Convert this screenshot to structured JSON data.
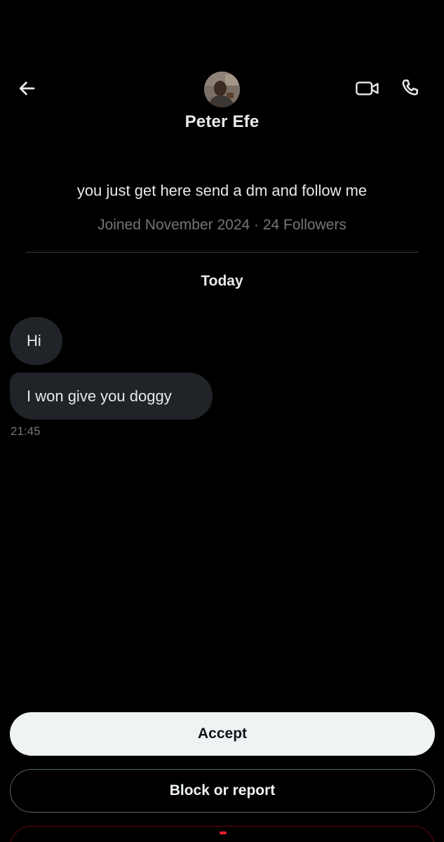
{
  "header": {
    "contact_name": "Peter Efe",
    "back_icon": "arrow-left-icon",
    "video_icon": "video-camera-icon",
    "call_icon": "phone-icon"
  },
  "profile": {
    "bio": "you just get here send a dm and follow me",
    "meta": "Joined November 2024 · 24 Followers"
  },
  "conversation": {
    "date_separator": "Today",
    "messages": [
      {
        "text": "Hi"
      },
      {
        "text": "I won give you doggy"
      }
    ],
    "timestamp": "21:45"
  },
  "actions": {
    "accept_label": "Accept",
    "block_label": "Block or report"
  },
  "colors": {
    "background": "#000000",
    "text_primary": "#e7e9ea",
    "text_secondary": "#71767b",
    "bubble": "#202327",
    "accept_bg": "#eff3f4",
    "danger": "#f4212e"
  }
}
